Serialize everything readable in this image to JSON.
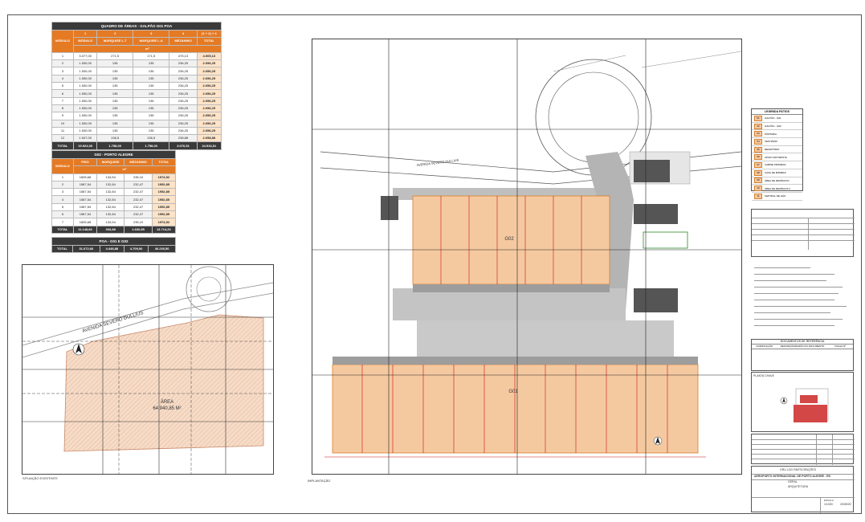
{
  "table1": {
    "title": "QUADRO DE ÁREAS - GALPÃO G01 POA",
    "row_header": "MÓDULO",
    "col_numbers": [
      "1",
      "2",
      "3",
      "4",
      "(1 + 2) + 4"
    ],
    "columns": [
      "MÓDULO",
      "MARQUISE L.T",
      "MARQUISE L.A",
      "MEZANINO",
      "TOTAL"
    ],
    "unit": "m²",
    "rows": [
      [
        "1",
        "3.077,00",
        "271,5",
        "171,5",
        "475,13",
        "4.005,13"
      ],
      [
        "2",
        "1.530,00",
        "135",
        "135",
        "236,25",
        "2.056,25"
      ],
      [
        "3",
        "1.530,00",
        "135",
        "135",
        "236,25",
        "2.056,25"
      ],
      [
        "4",
        "1.530,00",
        "135",
        "135",
        "236,25",
        "2.056,25"
      ],
      [
        "5",
        "1.530,00",
        "135",
        "135",
        "236,25",
        "2.056,25"
      ],
      [
        "6",
        "1.530,00",
        "135",
        "135",
        "236,25",
        "2.056,25"
      ],
      [
        "7",
        "1.530,00",
        "135",
        "135",
        "236,25",
        "2.056,25"
      ],
      [
        "8",
        "1.530,00",
        "135",
        "135",
        "236,25",
        "2.056,25"
      ],
      [
        "9",
        "1.530,00",
        "135",
        "135",
        "236,25",
        "2.056,25"
      ],
      [
        "10",
        "1.530,00",
        "135",
        "135",
        "236,25",
        "2.056,25"
      ],
      [
        "11",
        "1.530,00",
        "135",
        "135",
        "236,25",
        "2.056,25"
      ],
      [
        "12",
        "1.547,00",
        "136,5",
        "136,5",
        "238,88",
        "2.058,88"
      ]
    ],
    "total": [
      "TOTAL",
      "19.924,00",
      "1.758,00",
      "1.758,00",
      "3.076,51",
      "24.516,51"
    ]
  },
  "table2": {
    "title": "G02 - PORTO ALEGRE",
    "columns": [
      "MÓDULO",
      "PISO",
      "MARQUISE",
      "MEZANINO",
      "TOTAL"
    ],
    "unit": "m²",
    "rows": [
      [
        "1",
        "1605,68",
        "134,54",
        "235,10",
        "1974,52"
      ],
      [
        "2",
        "1587,54",
        "132,84",
        "232,47",
        "1952,85"
      ],
      [
        "3",
        "1587,54",
        "132,84",
        "232,47",
        "1952,85"
      ],
      [
        "4",
        "1587,54",
        "132,84",
        "232,47",
        "1952,85"
      ],
      [
        "5",
        "1587,54",
        "132,84",
        "232,47",
        "1952,85"
      ],
      [
        "6",
        "1587,54",
        "132,84",
        "232,47",
        "1952,85"
      ],
      [
        "7",
        "1605,68",
        "134,54",
        "235,10",
        "1974,52"
      ]
    ],
    "total": [
      "TOTAL",
      "11.148,66",
      "933,88",
      "1.630,55",
      "13.714,20"
    ]
  },
  "table3": {
    "title": "POA - G01 E G02",
    "total": [
      "TOTAL",
      "31.072,66",
      "4.448,88",
      "4.709,00",
      "40.230,50"
    ]
  },
  "site_plan": {
    "road_label": "AVENIDA SEVERO DULLIUS",
    "area_label": "ÁREA",
    "area_value": "64.940,85 M²",
    "caption": "SITUAÇÃO EXISTENTE"
  },
  "main_plan": {
    "building_top_label": "G02",
    "building_bottom_label": "G01",
    "road_label": "AVENIDA SEVERO DULLIUS",
    "caption": "IMPLANTAÇÃO"
  },
  "legend": {
    "title": "LEGENDA PÁTIOS",
    "items": [
      {
        "code": "01",
        "label": "GALPÃO - G01"
      },
      {
        "code": "02",
        "label": "GALPÃO - G02"
      },
      {
        "code": "03",
        "label": "PORTARIA"
      },
      {
        "code": "04",
        "label": "VESTIÁRIO"
      },
      {
        "code": "05",
        "label": "REFEITÓRIO"
      },
      {
        "code": "06",
        "label": "APOIO MOTORISTA"
      },
      {
        "code": "07",
        "label": "CABINE PRIMÁRIA"
      },
      {
        "code": "08",
        "label": "CASA DE BOMBAS"
      },
      {
        "code": "09",
        "label": "ÁREA DE RESÍDUOS I"
      },
      {
        "code": "10",
        "label": "ÁREA DE RESÍDUOS II"
      },
      {
        "code": "11",
        "label": "CENTRAL DE GÁS"
      }
    ]
  },
  "title_block": {
    "airport": "AEROPORTO INTERNACIONAL DE PORTO ALEGRE - RS",
    "discipline_1": "GERAL",
    "discipline_2": "ARQUITETURA",
    "company": "GRU LOG PARTICIPAÇÕES",
    "ref_title": "DOCUMENTOS DE REFERÊNCIA",
    "ref_col_1": "CODIFICAÇÃO",
    "ref_col_2": "DESCRIÇÃO/RAZÃO DO DOCUMENTO",
    "ref_col_3": "FOLHA Nº",
    "planta_label": "PLANTA CHAVE",
    "scale_label": "ESCALA",
    "scale_value": "1/1000",
    "date_value": "20/05/20"
  },
  "colors": {
    "building": "#f5c9a0",
    "building_border": "#d87f2a",
    "accent_orange": "#e57a24",
    "header_dark": "#3a3a3a",
    "grid_red": "#cc1111",
    "hatch": "#f2d3bd"
  }
}
